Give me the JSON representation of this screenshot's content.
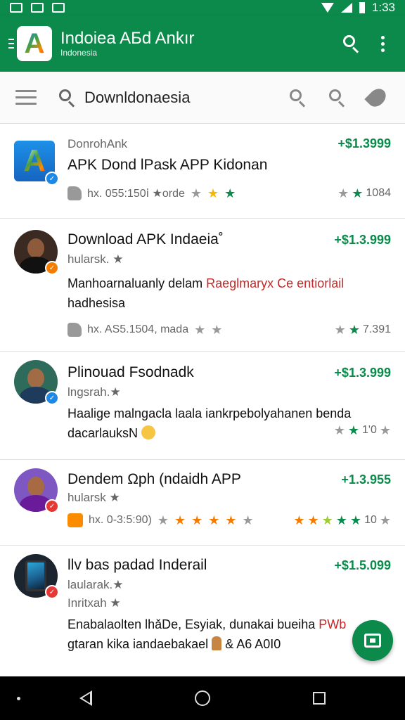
{
  "status_bar": {
    "time": "1:33"
  },
  "app_bar": {
    "title": "Indoiea AБd Ankır",
    "subtitle": "Indonesia"
  },
  "search": {
    "query": "Downldonaesia"
  },
  "items": [
    {
      "developer": "DonrohAnk",
      "title": "APK Dond lPask APP Kidonan",
      "price": "+$1.3999",
      "meta_left": "hx. 055:150ⅰ ★orde",
      "rating_count": "1084"
    },
    {
      "title": "Download APK Indaeia˚",
      "price": "+$1.3.999",
      "subtitle": "hularsk. ★",
      "desc_line1": "Manhoarnaluanly delam ",
      "desc_red": "Raeglmaryx Ce entiorlail",
      "desc_line2": "hadhesisa",
      "meta_left": "hx. AS5.1504, madа",
      "rating_count": "7.391"
    },
    {
      "title": "Plinouad Fsodnadk",
      "price": "+$1.3.999",
      "subtitle": "lngsrah.★",
      "desc_line1": "Haalige malngacla laala iankrpebolyahanen benda",
      "desc_line2": "dacarlauksN",
      "rating_count": "1'0"
    },
    {
      "title": "Dendem Ωph (ndaidh APP",
      "price": "+1.3.955",
      "subtitle": "hularsk ★",
      "meta_left": "hx. 0-3:5:90)",
      "rating_count": "10"
    },
    {
      "title": "llv bas padad Inderail",
      "price": "+$1.5.099",
      "subtitle": "laularak.★",
      "subtitle2": "Inritxah ★",
      "desc_line1": "Enabalaolten lhǎDe, Esyiak, dunakai bueiha ",
      "desc_red": "PWb",
      "desc_line2": "gtaran kika iandaebakael",
      "desc_tail": "& A6 A0I0"
    }
  ],
  "colors": {
    "primary": "#0b8a4c",
    "price": "#0b8a4c",
    "accent_red": "#c62828"
  }
}
